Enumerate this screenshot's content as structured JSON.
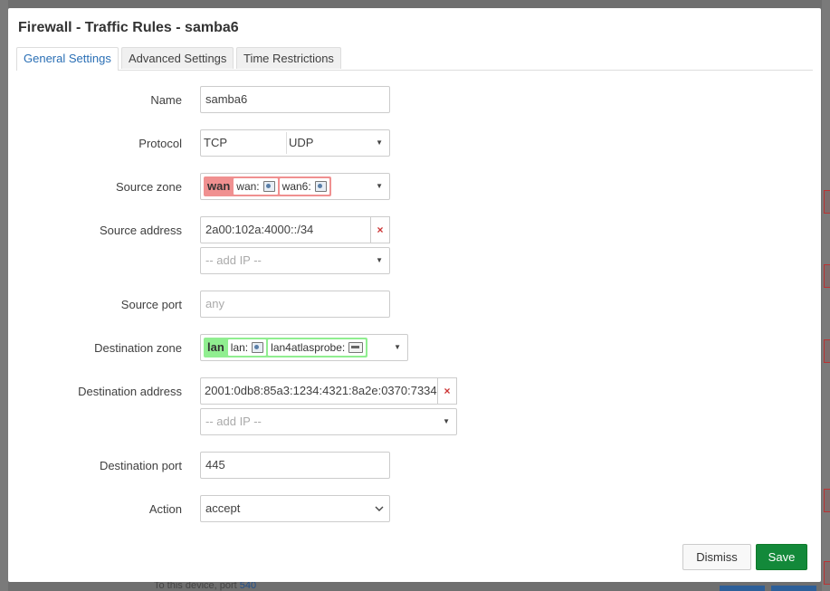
{
  "background": {
    "bottom_text": "To this device, port",
    "bottom_link": "540"
  },
  "modal": {
    "title": "Firewall - Traffic Rules - samba6"
  },
  "tabs": [
    {
      "label": "General Settings",
      "active": true
    },
    {
      "label": "Advanced Settings",
      "active": false
    },
    {
      "label": "Time Restrictions",
      "active": false
    }
  ],
  "form": {
    "name": {
      "label": "Name",
      "value": "samba6"
    },
    "protocol": {
      "label": "Protocol",
      "values": [
        "TCP",
        "UDP"
      ]
    },
    "source_zone": {
      "label": "Source zone",
      "zone": "wan",
      "zone_color": "#f09090",
      "devices": [
        "wan:",
        "wan6:"
      ]
    },
    "source_address": {
      "label": "Source address",
      "value": "2a00:102a:4000::/34",
      "add_placeholder": "-- add IP --"
    },
    "source_port": {
      "label": "Source port",
      "placeholder": "any"
    },
    "destination_zone": {
      "label": "Destination zone",
      "zone": "lan",
      "zone_color": "#90ee90",
      "devices": [
        "lan:",
        "lan4atlasprobe:"
      ]
    },
    "destination_address": {
      "label": "Destination address",
      "value": "2001:0db8:85a3:1234:4321:8a2e:0370:7334",
      "add_placeholder": "-- add IP --"
    },
    "destination_port": {
      "label": "Destination port",
      "value": "445"
    },
    "action": {
      "label": "Action",
      "value": "accept"
    }
  },
  "buttons": {
    "dismiss": "Dismiss",
    "save": "Save"
  },
  "icons": {
    "remove": "×",
    "dropdown": "▼",
    "chevron": "⌄"
  }
}
